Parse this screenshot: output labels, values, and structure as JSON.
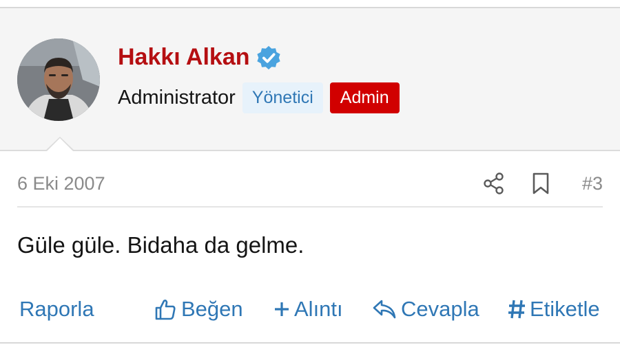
{
  "user": {
    "name": "Hakkı Alkan",
    "title": "Administrator",
    "badges": [
      "Yönetici",
      "Admin"
    ],
    "verified_icon": "verified-check-icon",
    "avatar_icon": "avatar-photo"
  },
  "post": {
    "date": "6 Eki 2007",
    "number": "#3",
    "message": "Güle güle. Bidaha da gelme.",
    "meta_icons": [
      "share-icon",
      "bookmark-icon"
    ]
  },
  "actions": {
    "report": "Raporla",
    "like": "Beğen",
    "quote": "Alıntı",
    "reply": "Cevapla",
    "tag": "Etiketle"
  },
  "colors": {
    "username": "#b50f12",
    "link": "#2f77b5",
    "admin_badge": "#d10000",
    "yonetici_badge_bg": "#e7f2fb",
    "verified": "#4aa3df",
    "muted": "#8a8a8a"
  }
}
